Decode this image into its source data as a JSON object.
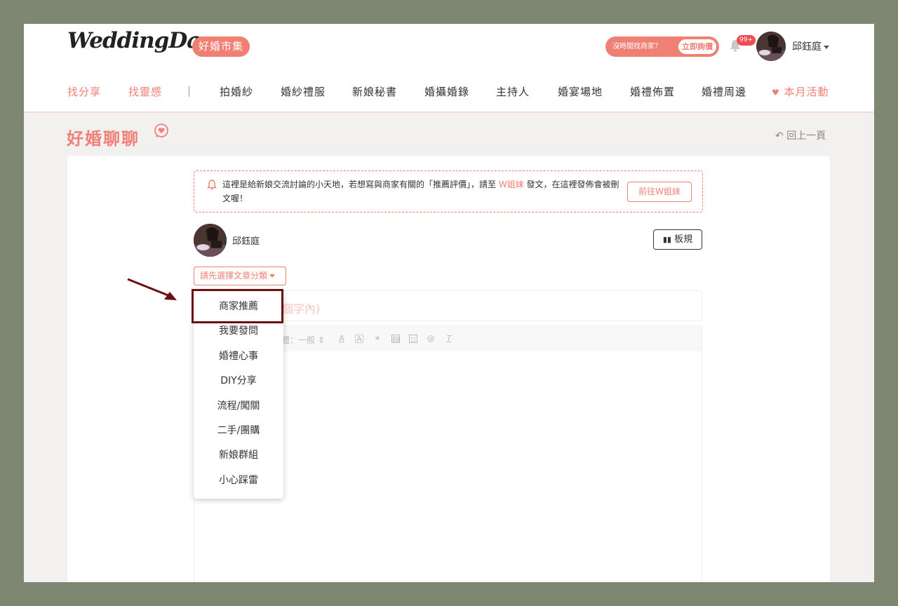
{
  "header": {
    "logo_text": "WeddingDay",
    "market_badge": "好婚市集",
    "promo_text": "沒時間找商家？",
    "promo_action": "立即詢價",
    "notification_count": "99+",
    "user_name": "邱鈺庭"
  },
  "nav": {
    "items": [
      "找分享",
      "找靈感",
      "拍婚紗",
      "婚紗禮服",
      "新娘秘書",
      "婚攝婚錄",
      "主持人",
      "婚宴場地",
      "婚禮佈置",
      "婚禮周邊",
      "本月活動"
    ]
  },
  "page": {
    "title": "好婚聊聊",
    "back_label": "回上一頁"
  },
  "notice": {
    "text_before": "這裡是給新娘交流討論的小天地，若想寫與商家有關的「推薦評價」，請至 ",
    "highlight": "W姐妹",
    "text_after": " 發文，在這裡發佈會被刪文喔！",
    "button_label": "前往W姐妹"
  },
  "post": {
    "author": "邱鈺庭",
    "rules_button": "板規",
    "category_placeholder": "請先選擇文章分類",
    "title_placeholder_visible": "個字內)",
    "toolbar_font_label": "體：一般"
  },
  "dropdown": {
    "options": [
      "商家推薦",
      "我要發問",
      "婚禮心事",
      "DIY分享",
      "流程/闖關",
      "二手/團購",
      "新娘群組",
      "小心踩雷"
    ],
    "highlighted_index": 0
  },
  "colors": {
    "accent": "#f07f74",
    "highlight_box": "#6e0f0f",
    "backdrop": "#7e8772"
  }
}
